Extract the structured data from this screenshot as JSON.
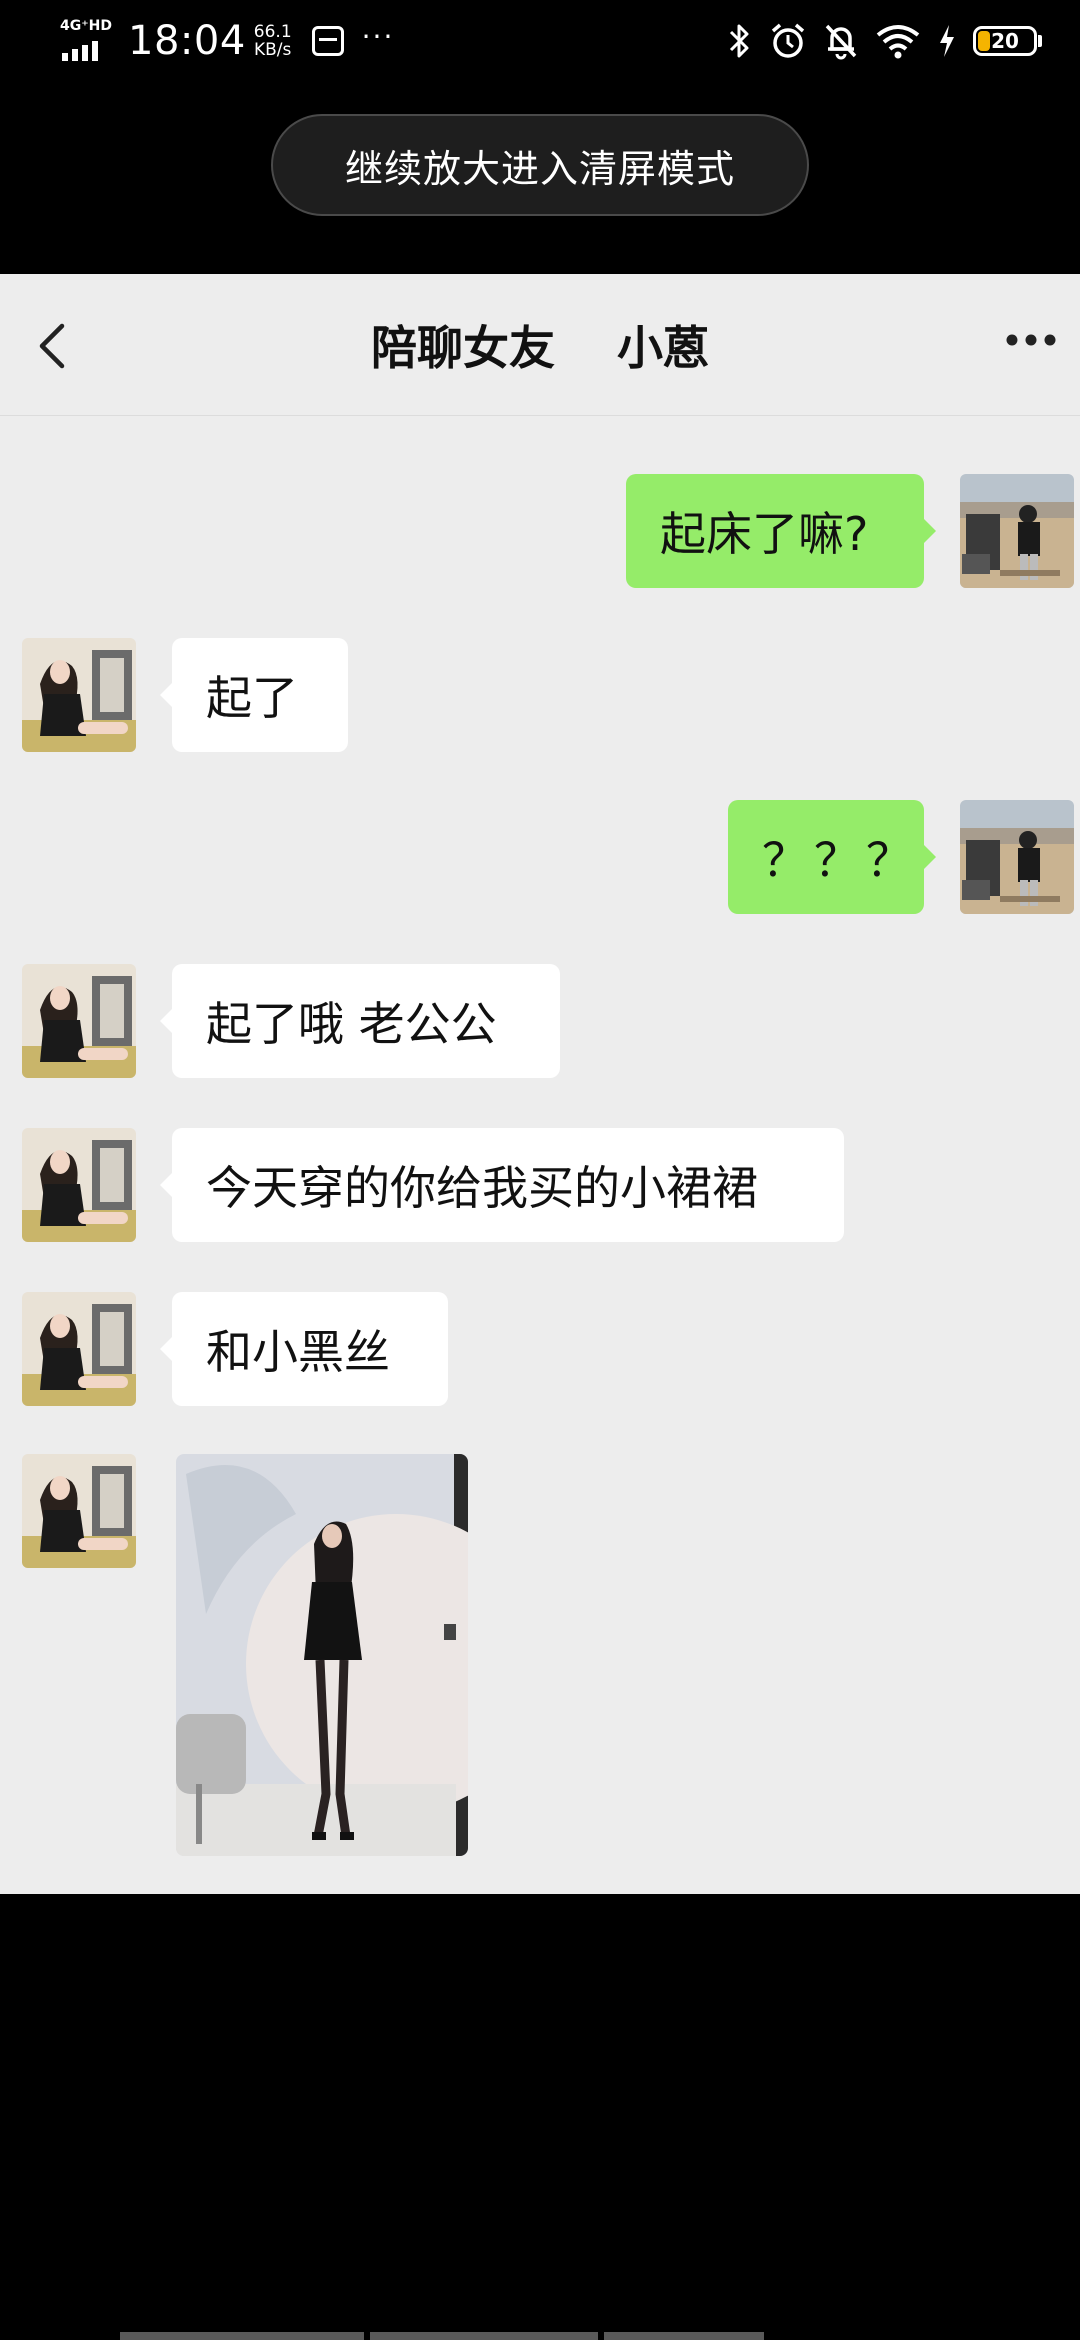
{
  "status_bar": {
    "network": "4G⁺HD",
    "time": "18:04",
    "speed_value": "66.1",
    "speed_unit": "KB/s",
    "overflow": "···",
    "battery_level": "20",
    "icons": [
      "signal-icon",
      "notification-card-icon",
      "bluetooth-icon",
      "alarm-icon",
      "mute-bell-icon",
      "wifi-icon",
      "charging-icon",
      "battery-icon"
    ]
  },
  "toast": {
    "text": "继续放大进入清屏模式"
  },
  "header": {
    "title": "陪聊女友",
    "subtitle": "小蒽",
    "back_icon": "chevron-left-icon",
    "more_icon": "more-dots-icon"
  },
  "messages": [
    {
      "side": "out",
      "text": "起床了嘛?"
    },
    {
      "side": "in",
      "text": "起了"
    },
    {
      "side": "out",
      "text": "？？？"
    },
    {
      "side": "in",
      "text": "起了哦 老公公"
    },
    {
      "side": "in",
      "text": "今天穿的你给我买的小裙裙"
    },
    {
      "side": "in",
      "text": "和小黑丝"
    },
    {
      "side": "in",
      "type": "image"
    }
  ],
  "colors": {
    "outgoing_bubble": "#95ec69",
    "incoming_bubble": "#ffffff",
    "chat_background": "#ededed",
    "battery_fill": "#f5b400"
  }
}
